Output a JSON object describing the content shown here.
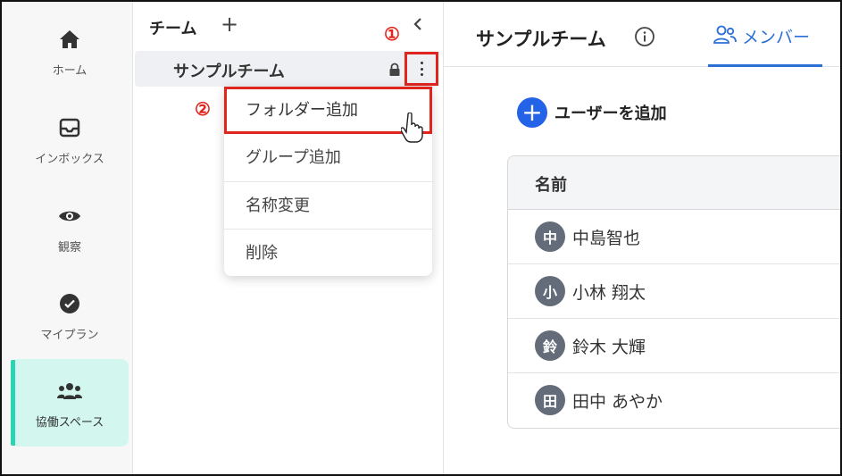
{
  "rail": {
    "items": [
      {
        "label": "ホーム",
        "icon": "home-icon"
      },
      {
        "label": "インボックス",
        "icon": "inbox-icon"
      },
      {
        "label": "観察",
        "icon": "eye-icon"
      },
      {
        "label": "マイプラン",
        "icon": "check-circle-icon"
      },
      {
        "label": "協働スペース",
        "icon": "group-icon",
        "active": true
      }
    ],
    "active_color": "#2ad3b4",
    "active_bg": "#d3f7ef"
  },
  "tree": {
    "header": "チーム",
    "add_symbol": "+",
    "team_name": "サンプルチーム"
  },
  "annotations": {
    "step1": "①",
    "step2": "②",
    "color": "#e0251f"
  },
  "menu": {
    "items": [
      "フォルダー追加",
      "グループ追加",
      "名称変更",
      "削除"
    ]
  },
  "main": {
    "title": "サンプルチーム",
    "tab_label": "メンバー",
    "tab_color": "#2b6fd6",
    "add_symbol": "+",
    "add_user_label": "ユーザーを追加",
    "table": {
      "header": "名前",
      "rows": [
        {
          "avatar": "中",
          "name": "中島智也"
        },
        {
          "avatar": "小",
          "name": "小林 翔太"
        },
        {
          "avatar": "鈴",
          "name": "鈴木 大輝"
        },
        {
          "avatar": "田",
          "name": "田中 あやか"
        }
      ]
    }
  }
}
